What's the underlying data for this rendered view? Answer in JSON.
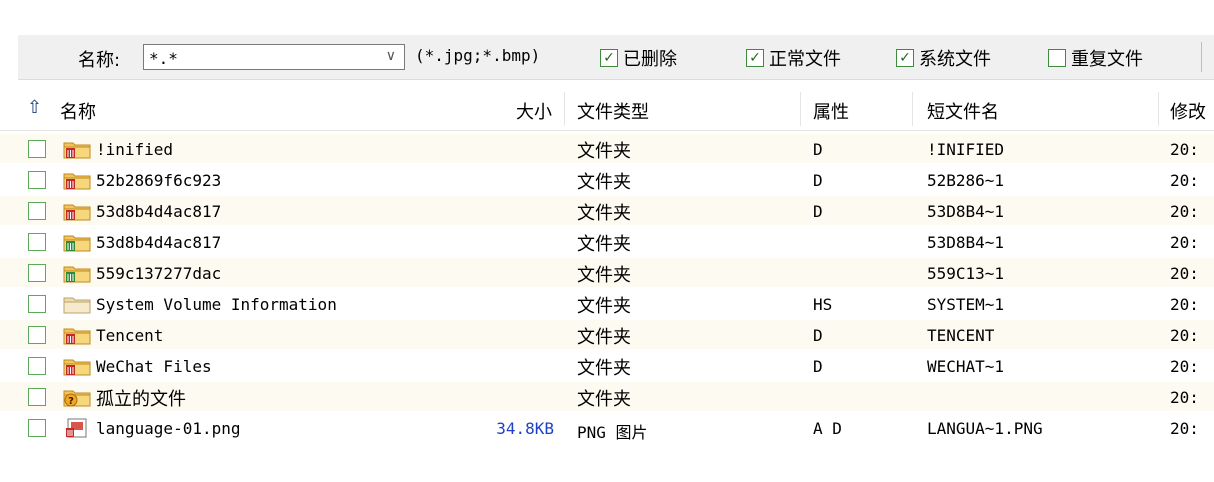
{
  "toolbar": {
    "name_label": "名称:",
    "name_value": "*.*",
    "filter_hint": "(*.jpg;*.bmp)",
    "checkboxes": [
      {
        "label": "已删除",
        "checked": true
      },
      {
        "label": "正常文件",
        "checked": true
      },
      {
        "label": "系统文件",
        "checked": true
      },
      {
        "label": "重复文件",
        "checked": false
      }
    ]
  },
  "columns": {
    "name": "名称",
    "size": "大小",
    "type": "文件类型",
    "attr": "属性",
    "short": "短文件名",
    "modified": "修改"
  },
  "files": [
    {
      "name": "!inified",
      "icon": "deleted-folder-icon",
      "size": "",
      "type": "文件夹",
      "attr": "D",
      "short": "!INIFIED",
      "modified": "20:"
    },
    {
      "name": "52b2869f6c923",
      "icon": "deleted-folder-icon",
      "size": "",
      "type": "文件夹",
      "attr": "D",
      "short": "52B286~1",
      "modified": "20:"
    },
    {
      "name": "53d8b4d4ac817",
      "icon": "deleted-folder-icon",
      "size": "",
      "type": "文件夹",
      "attr": "D",
      "short": "53D8B4~1",
      "modified": "20:"
    },
    {
      "name": "53d8b4d4ac817",
      "icon": "recoverable-folder-icon",
      "size": "",
      "type": "文件夹",
      "attr": "",
      "short": "53D8B4~1",
      "modified": "20:"
    },
    {
      "name": "559c137277dac",
      "icon": "recoverable-folder-icon",
      "size": "",
      "type": "文件夹",
      "attr": "",
      "short": "559C13~1",
      "modified": "20:"
    },
    {
      "name": "System Volume Information",
      "icon": "system-folder-icon",
      "size": "",
      "type": "文件夹",
      "attr": "HS",
      "short": "SYSTEM~1",
      "modified": "20:"
    },
    {
      "name": "Tencent",
      "icon": "deleted-folder-icon",
      "size": "",
      "type": "文件夹",
      "attr": "D",
      "short": "TENCENT",
      "modified": "20:"
    },
    {
      "name": "WeChat Files",
      "icon": "deleted-folder-icon",
      "size": "",
      "type": "文件夹",
      "attr": "D",
      "short": "WECHAT~1",
      "modified": "20:"
    },
    {
      "name": "孤立的文件",
      "icon": "orphan-folder-icon",
      "size": "",
      "type": "文件夹",
      "attr": "",
      "short": "",
      "modified": "20:"
    },
    {
      "name": "language-01.png",
      "icon": "deleted-image-file-icon",
      "size": "34.8KB",
      "type": "PNG 图片",
      "attr": "A D",
      "short": "LANGUA~1.PNG",
      "modified": "20:"
    }
  ]
}
